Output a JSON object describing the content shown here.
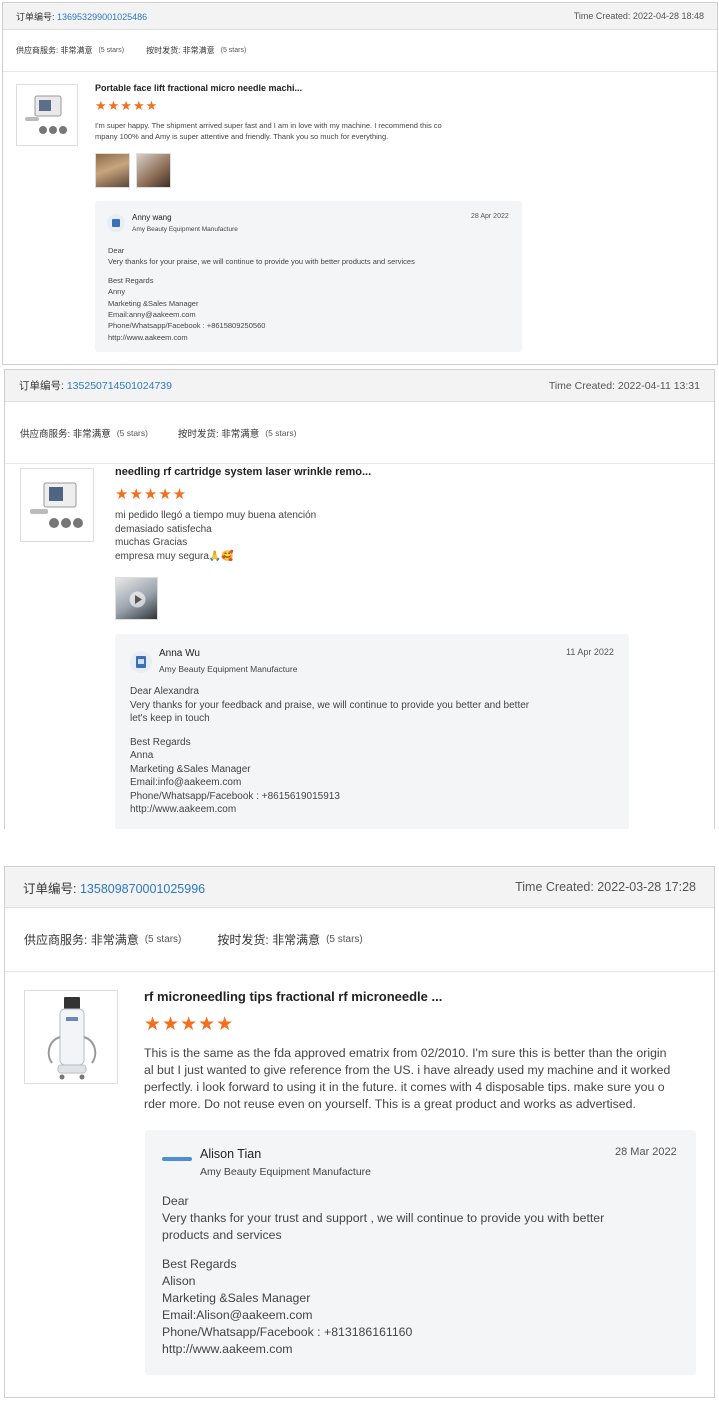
{
  "reviews": [
    {
      "order_label": "订单编号:",
      "order_number": "136953299001025486",
      "time_created": "Time Created: 2022-04-28 18:48",
      "supplier_service_label": "供应商服务:",
      "supplier_service_value": "非常满意",
      "supplier_service_stars": "(5 stars)",
      "ontime_label": "按时发货:",
      "ontime_value": "非常满意",
      "ontime_stars": "(5 stars)",
      "product_title": "Portable face lift fractional micro needle machi...",
      "rating": "★★★★★",
      "review_lines": [
        "I'm super happy.  The shipment arrived super fast and I am in love with my machine.  I recommend this co",
        "mpany 100% and Amy is super attentive and friendly.  Thank you so much for everything."
      ],
      "reply": {
        "name": "Anny wang",
        "company": "Amy Beauty Equipment Manufacture",
        "date": "28 Apr 2022",
        "lines": [
          "Dear",
          "Very thanks for your praise, we will continue to provide you with better products and services",
          "",
          "Best Regards",
          "Anny",
          "Marketing &Sales Manager",
          "Email:anny@aakeem.com",
          "Phone/Whatsapp/Facebook : +8615809250560",
          "http://www.aakeem.com"
        ]
      }
    },
    {
      "order_label": "订单编号:",
      "order_number": "135250714501024739",
      "time_created": "Time Created: 2022-04-11 13:31",
      "supplier_service_label": "供应商服务:",
      "supplier_service_value": "非常满意",
      "supplier_service_stars": "(5 stars)",
      "ontime_label": "按时发货:",
      "ontime_value": "非常满意",
      "ontime_stars": "(5 stars)",
      "product_title": "needling rf cartridge system laser wrinkle remo...",
      "rating": "★★★★★",
      "review_lines": [
        "mi pedido llegó a tiempo muy buena atención",
        "demasiado satisfecha",
        "muchas Gracias",
        "empresa muy segura🙏🥰"
      ],
      "reply": {
        "name": "Anna Wu",
        "company": "Amy Beauty Equipment Manufacture",
        "date": "11 Apr 2022",
        "lines": [
          "Dear Alexandra",
          "Very thanks for your feedback and praise, we will continue to provide you better and better",
          "let's keep in touch",
          "",
          "Best Regards",
          "Anna",
          "Marketing &Sales Manager",
          "Email:info@aakeem.com",
          "Phone/Whatsapp/Facebook : +8615619015913",
          "http://www.aakeem.com"
        ]
      }
    },
    {
      "order_label": "订单编号:",
      "order_number": "135809870001025996",
      "time_created": "Time Created: 2022-03-28 17:28",
      "supplier_service_label": "供应商服务:",
      "supplier_service_value": "非常满意",
      "supplier_service_stars": "(5 stars)",
      "ontime_label": "按时发货:",
      "ontime_value": "非常满意",
      "ontime_stars": "(5 stars)",
      "product_title": "rf microneedling tips fractional rf microneedle ...",
      "rating": "★★★★★",
      "review_lines": [
        "This is the same as the fda approved ematrix from 02/2010. I'm sure this is better than the origin",
        "al but I just wanted to give reference from the US. i have already used my machine and it worked",
        "perfectly. i look forward to using it in the future. it comes with 4 disposable tips. make sure you o",
        "rder more. Do not reuse even on yourself. This is a great product and works as advertised."
      ],
      "reply": {
        "name": "Alison Tian",
        "company": "Amy Beauty Equipment Manufacture",
        "date": "28 Mar 2022",
        "lines": [
          "Dear",
          "Very thanks for your trust and support , we will continue to provide you with better",
          "products and services",
          "",
          "Best Regards",
          "Alison",
          "Marketing &Sales Manager",
          "Email:Alison@aakeem.com",
          "Phone/Whatsapp/Facebook : +813186161160",
          "http://www.aakeem.com"
        ]
      }
    }
  ],
  "colors": {
    "link": "#2d78c6",
    "star": "#f36f1c",
    "reply_bg": "#f4f5f6",
    "header_bg": "#f3f3f3"
  }
}
